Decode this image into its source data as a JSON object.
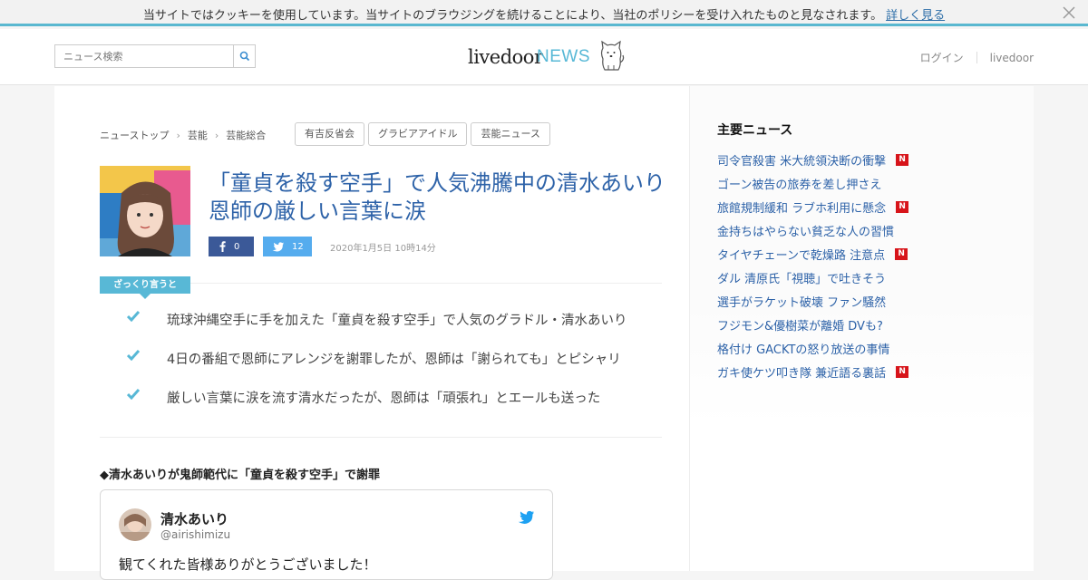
{
  "cookie": {
    "message": "当サイトではクッキーを使用しています。当サイトのブラウジングを続けることにより、当社のポリシーを受け入れたものと見なされます。",
    "link": "詳しく見る"
  },
  "header": {
    "search_placeholder": "ニュース検索",
    "logo_livedoor": "livedoor",
    "logo_news": "NEWS",
    "login": "ログイン",
    "livedoor": "livedoor"
  },
  "breadcrumb": [
    "ニューストップ",
    "芸能",
    "芸能総合"
  ],
  "tags": [
    "有吉反省会",
    "グラビアアイドル",
    "芸能ニュース"
  ],
  "article": {
    "title": "「童貞を殺す空手」で人気沸騰中の清水あいり 恩師の厳しい言葉に涙",
    "facebook_count": "0",
    "twitter_count": "12",
    "date": "2020年1月5日 10時14分",
    "summary_label": "ざっくり言うと",
    "summary": [
      "琉球沖縄空手に手を加えた「童貞を殺す空手」で人気のグラドル・清水あいり",
      "4日の番組で恩師にアレンジを謝罪したが、恩師は「謝られても」とピシャリ",
      "厳しい言葉に涙を流す清水だったが、恩師は「頑張れ」とエールも送った"
    ],
    "subheading": "◆清水あいりが鬼師範代に「童貞を殺す空手」で謝罪"
  },
  "tweet": {
    "name": "清水あいり",
    "handle": "@airishimizu",
    "text": "観てくれた皆様ありがとうございました！"
  },
  "sidebar": {
    "title": "主要ニュース",
    "news": [
      {
        "text": "司令官殺害 米大統領決断の衝撃",
        "new": true
      },
      {
        "text": "ゴーン被告の旅券を差し押さえ",
        "new": false
      },
      {
        "text": "旅館規制緩和 ラブホ利用に懸念",
        "new": true
      },
      {
        "text": "金持ちはやらない貧乏な人の習慣",
        "new": false
      },
      {
        "text": "タイヤチェーンで乾燥路 注意点",
        "new": true
      },
      {
        "text": "ダル 清原氏「視聴」で吐きそう",
        "new": false
      },
      {
        "text": "選手がラケット破壊 ファン騒然",
        "new": false
      },
      {
        "text": "フジモン&優樹菜が離婚 DVも?",
        "new": false
      },
      {
        "text": "格付け GACKTの怒り放送の事情",
        "new": false
      },
      {
        "text": "ガキ使ケツ叩き隊 兼近語る裏話",
        "new": true
      }
    ],
    "new_badge": "N"
  },
  "colors": {
    "accent": "#58b8d6",
    "link": "#2d62a8",
    "facebook": "#3b5998",
    "twitter": "#55acee",
    "new_badge": "#d7141a"
  }
}
